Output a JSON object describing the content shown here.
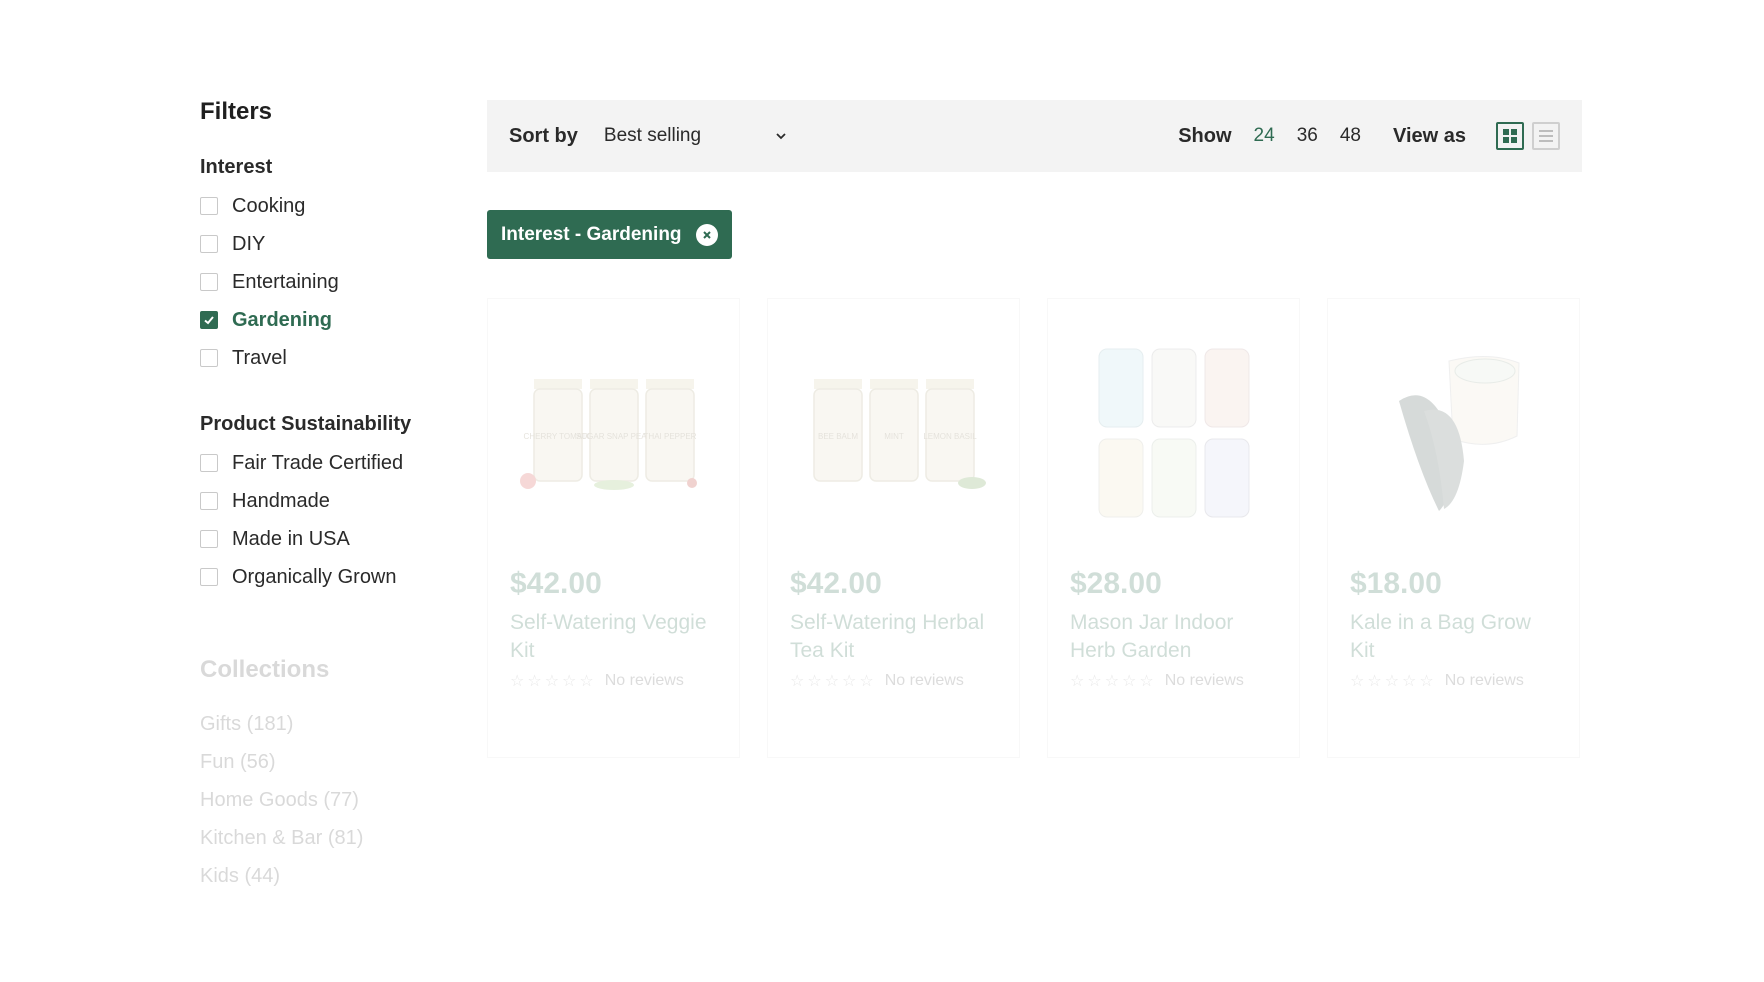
{
  "sidebar": {
    "title": "Filters",
    "groups": [
      {
        "title": "Interest",
        "options": [
          {
            "label": "Cooking",
            "checked": false
          },
          {
            "label": "DIY",
            "checked": false
          },
          {
            "label": "Entertaining",
            "checked": false
          },
          {
            "label": "Gardening",
            "checked": true
          },
          {
            "label": "Travel",
            "checked": false
          }
        ]
      },
      {
        "title": "Product Sustainability",
        "options": [
          {
            "label": "Fair Trade Certified",
            "checked": false
          },
          {
            "label": "Handmade",
            "checked": false
          },
          {
            "label": "Made in USA",
            "checked": false
          },
          {
            "label": "Organically Grown",
            "checked": false
          }
        ]
      }
    ],
    "collections": {
      "title": "Collections",
      "items": [
        "Gifts (181)",
        "Fun (56)",
        "Home Goods (77)",
        "Kitchen & Bar (81)",
        "Kids (44)"
      ]
    }
  },
  "toolbar": {
    "sort_label": "Sort by",
    "sort_value": "Best selling",
    "show_label": "Show",
    "show_options": [
      "24",
      "36",
      "48"
    ],
    "show_active": "24",
    "view_label": "View as",
    "view_active": "grid"
  },
  "active_filter": {
    "label": "Interest - Gardening"
  },
  "products": [
    {
      "price": "$42.00",
      "title": "Self-Watering Veggie Kit",
      "reviews": "No reviews",
      "jar_labels": [
        "CHERRY TOMATO",
        "SUGAR SNAP PEAS",
        "THAI PEPPER"
      ]
    },
    {
      "price": "$42.00",
      "title": "Self-Watering Herbal Tea Kit",
      "reviews": "No reviews",
      "jar_labels": [
        "BEE BALM",
        "MINT",
        "LEMON BASIL"
      ]
    },
    {
      "price": "$28.00",
      "title": "Mason Jar Indoor Herb Garden",
      "reviews": "No reviews"
    },
    {
      "price": "$18.00",
      "title": "Kale in a Bag Grow Kit",
      "reviews": "No reviews"
    }
  ],
  "colors": {
    "accent": "#2f6b52",
    "toolbar_bg": "#f3f3f3"
  }
}
